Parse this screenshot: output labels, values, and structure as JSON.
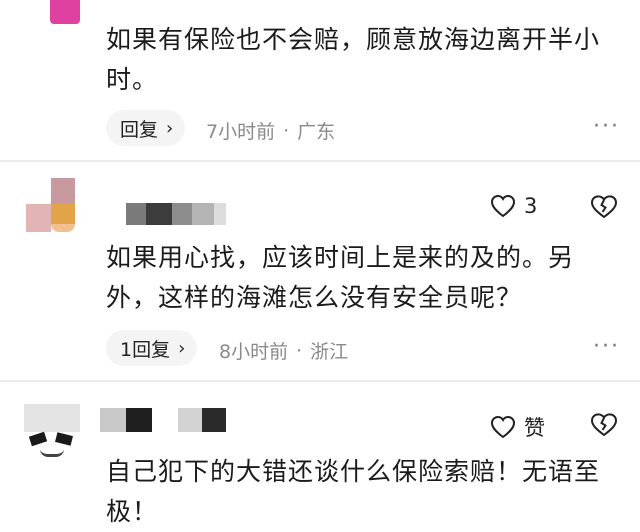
{
  "comments": [
    {
      "text_lines": [
        "如果有保险也不会赔，顾意放海边离开半小",
        "时。"
      ],
      "reply_label": "回复",
      "time": "7小时前",
      "location": "广东",
      "more": "···"
    },
    {
      "like_count": "3",
      "text_lines": [
        "如果用心找，应该时间上是来的及的。另",
        "外，这样的海滩怎么没有安全员呢？"
      ],
      "reply_label": "1回复",
      "time": "8小时前",
      "location": "浙江",
      "more": "···"
    },
    {
      "like_label": "赞",
      "text_lines": [
        "自己犯下的大错还谈什么保险索赔！无语至",
        "极！"
      ]
    }
  ],
  "colors": {
    "accent_pink": "#e040a0",
    "meta_gray": "#8a8a8a",
    "pill_bg": "#f4f4f4",
    "divider": "#ececec"
  },
  "icons": {
    "like": "heart-outline-icon",
    "dislike": "broken-heart-icon",
    "reply_chevron": "chevron-right-icon",
    "more": "more-dots-icon"
  }
}
